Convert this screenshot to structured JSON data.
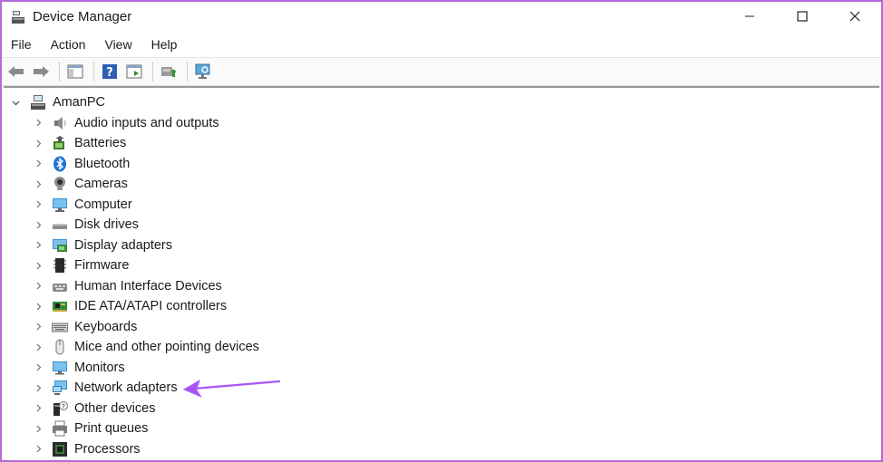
{
  "window": {
    "title": "Device Manager"
  },
  "menu": [
    {
      "label": "File"
    },
    {
      "label": "Action"
    },
    {
      "label": "View"
    },
    {
      "label": "Help"
    }
  ],
  "tree": {
    "root": "AmanPC",
    "items": [
      {
        "label": "Audio inputs and outputs",
        "icon": "speaker-icon"
      },
      {
        "label": "Batteries",
        "icon": "battery-icon"
      },
      {
        "label": "Bluetooth",
        "icon": "bluetooth-icon"
      },
      {
        "label": "Cameras",
        "icon": "camera-icon"
      },
      {
        "label": "Computer",
        "icon": "computer-icon"
      },
      {
        "label": "Disk drives",
        "icon": "disk-drive-icon"
      },
      {
        "label": "Display adapters",
        "icon": "display-adapter-icon"
      },
      {
        "label": "Firmware",
        "icon": "firmware-icon"
      },
      {
        "label": "Human Interface Devices",
        "icon": "hid-icon"
      },
      {
        "label": "IDE ATA/ATAPI controllers",
        "icon": "ide-controller-icon"
      },
      {
        "label": "Keyboards",
        "icon": "keyboard-icon"
      },
      {
        "label": "Mice and other pointing devices",
        "icon": "mouse-icon"
      },
      {
        "label": "Monitors",
        "icon": "monitor-icon"
      },
      {
        "label": "Network adapters",
        "icon": "network-adapter-icon"
      },
      {
        "label": "Other devices",
        "icon": "other-devices-icon"
      },
      {
        "label": "Print queues",
        "icon": "printer-icon"
      },
      {
        "label": "Processors",
        "icon": "processor-icon"
      }
    ]
  },
  "colors": {
    "annotation_arrow": "#a855f7",
    "window_border": "#b36ad8"
  }
}
